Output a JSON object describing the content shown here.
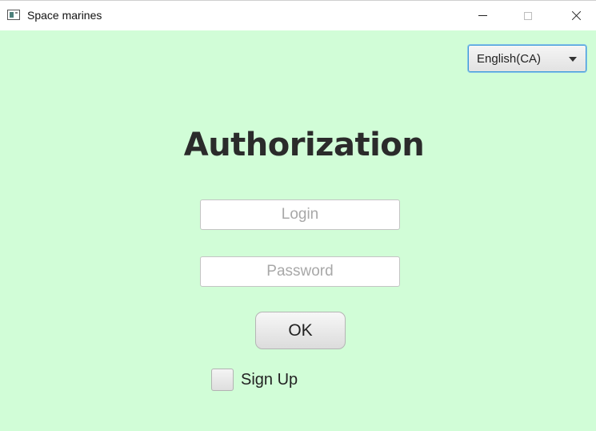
{
  "window": {
    "title": "Space marines",
    "icon": "app-window-icon"
  },
  "language": {
    "selected": "English(CA)",
    "icon": "chevron-down-icon"
  },
  "form": {
    "heading": "Authorization",
    "login_placeholder": "Login",
    "login_value": "",
    "password_placeholder": "Password",
    "password_value": "",
    "ok_label": "OK",
    "signup_label": "Sign Up",
    "signup_checked": false
  },
  "colors": {
    "background": "#d1fdd7",
    "accent": "#3a9bd8"
  }
}
